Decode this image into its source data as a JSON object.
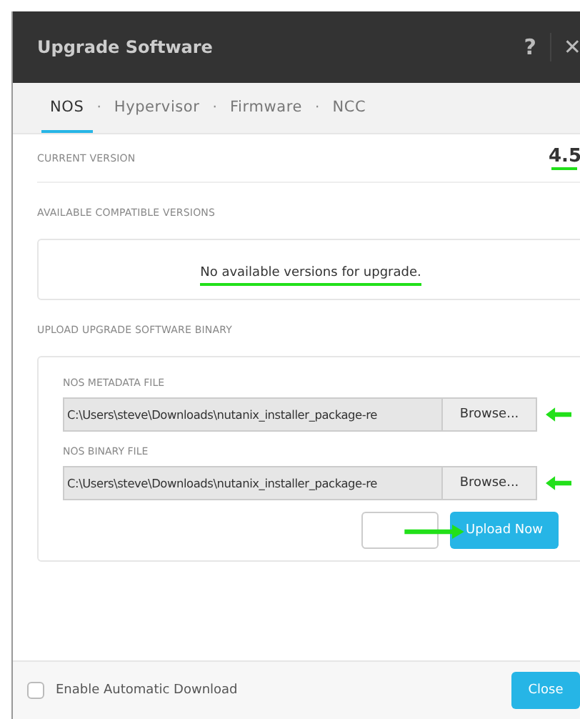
{
  "window": {
    "title": "Upgrade Software",
    "help": "?",
    "close": "✕"
  },
  "tab_separator": "·",
  "tabs": [
    {
      "label": "NOS",
      "selected": true
    },
    {
      "label": "Hypervisor",
      "selected": false
    },
    {
      "label": "Firmware",
      "selected": false
    },
    {
      "label": "NCC",
      "selected": false
    }
  ],
  "current_version": {
    "label": "CURRENT VERSION",
    "value": "4.5"
  },
  "available": {
    "label": "AVAILABLE COMPATIBLE VERSIONS",
    "message": "No available versions for upgrade."
  },
  "upload": {
    "label": "UPLOAD UPGRADE SOFTWARE BINARY",
    "files": [
      {
        "label": "NOS METADATA FILE",
        "value": "C:\\Users\\steve\\Downloads\\nutanix_installer_package-re",
        "button": "Browse..."
      },
      {
        "label": "NOS BINARY FILE",
        "value": "C:\\Users\\steve\\Downloads\\nutanix_installer_package-re",
        "button": "Browse..."
      }
    ],
    "primary_button": "Upload Now"
  },
  "footer": {
    "checkbox": {
      "label": "Enable Automatic Download",
      "checked": false
    },
    "button": "Close"
  }
}
